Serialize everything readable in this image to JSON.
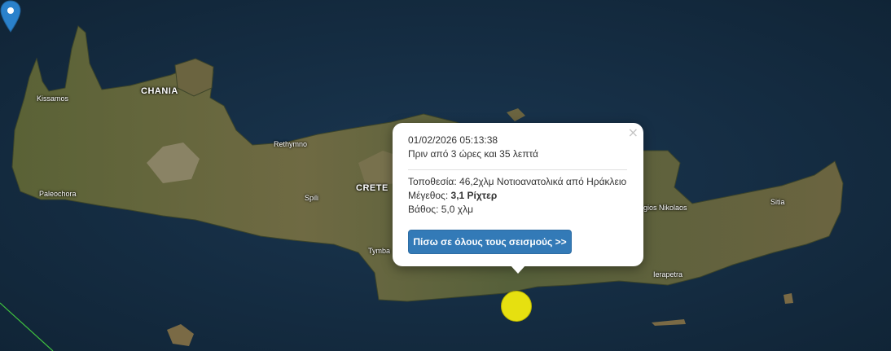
{
  "map": {
    "places": {
      "chania": "CHANIA",
      "kissamos": "Kissamos",
      "rethymno": "Rethymno",
      "crete": "CRETE",
      "paleochora": "Paleochora",
      "spili": "Spili",
      "tymbaki": "Tymba",
      "agios_nikolaos": "gios Nikolaos",
      "sitia": "Sitia",
      "ierapetra": "Ierapetra"
    }
  },
  "popup": {
    "datetime": "01/02/2026 05:13:38",
    "ago": "Πριν από 3 ώρες και 35 λεπτά",
    "location_label": "Τοποθεσία:",
    "location_value": "46,2χλμ Νοτιοανατολικά από Ηράκλειο",
    "magnitude_label": "Μέγεθος:",
    "magnitude_value": "3,1 Ρίχτερ",
    "depth_label": "Βάθος:",
    "depth_value": "5,0 χλμ",
    "back_button": "Πίσω σε όλους τους σεισμούς >>",
    "close_symbol": "×"
  },
  "colors": {
    "sea": "#13283a",
    "land_green": "#4e5a30",
    "land_brown": "#7a6a45",
    "button": "#337ab7",
    "quake_marker": "#e6e010",
    "pin": "#2a81cb"
  },
  "icons": {
    "marker": "map-pin-icon",
    "close": "close-icon"
  }
}
